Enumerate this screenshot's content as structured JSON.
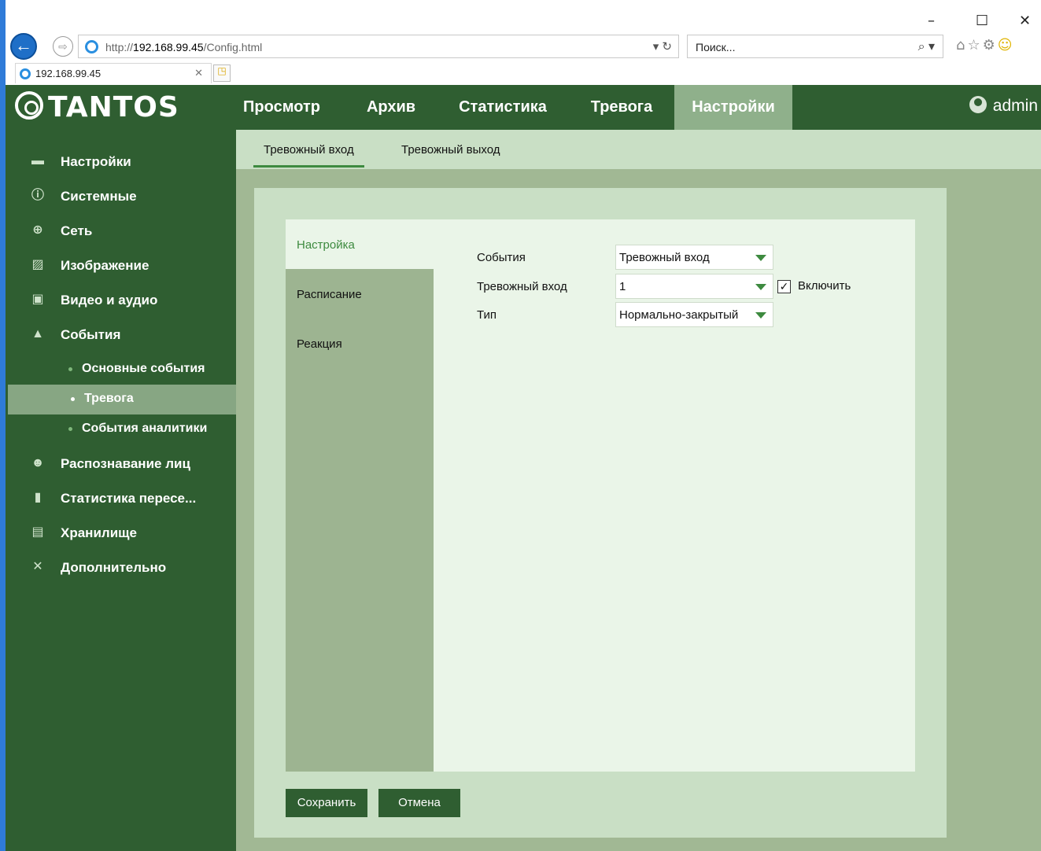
{
  "browser": {
    "url_prefix": "http://",
    "url_host": "192.168.99.45",
    "url_path": "/Config.html",
    "search_placeholder": "Поиск...",
    "tab_title": "192.168.99.45",
    "minimize": "–",
    "maximize": "☐",
    "close": "✕"
  },
  "app": {
    "logo": "TANTOS",
    "user": "admin"
  },
  "nav": [
    {
      "label": "Просмотр"
    },
    {
      "label": "Архив"
    },
    {
      "label": "Статистика"
    },
    {
      "label": "Тревога"
    },
    {
      "label": "Настройки"
    }
  ],
  "sidebar": {
    "items": [
      {
        "label": "Настройки"
      },
      {
        "label": "Системные"
      },
      {
        "label": "Сеть"
      },
      {
        "label": "Изображение"
      },
      {
        "label": "Видео и аудио"
      },
      {
        "label": "События"
      }
    ],
    "sub": [
      {
        "label": "Основные события"
      },
      {
        "label": "Тревога"
      },
      {
        "label": "События аналитики"
      }
    ],
    "items2": [
      {
        "label": "Распознавание лиц"
      },
      {
        "label": "Статистика пересе..."
      },
      {
        "label": "Хранилище"
      },
      {
        "label": "Дополнительно"
      }
    ]
  },
  "subtabs": [
    {
      "label": "Тревожный вход"
    },
    {
      "label": "Тревожный выход"
    }
  ],
  "left_menu": [
    {
      "label": "Настройка"
    },
    {
      "label": "Расписание"
    },
    {
      "label": "Реакция"
    }
  ],
  "form": {
    "events_label": "События",
    "events_value": "Тревожный вход",
    "alarm_in_label": "Тревожный вход",
    "alarm_in_value": "1",
    "enable_label": "Включить",
    "enable_checked": true,
    "type_label": "Тип",
    "type_value": "Нормально-закрытый"
  },
  "buttons": {
    "save": "Сохранить",
    "cancel": "Отмена"
  },
  "colors": {
    "header_bg": "#2f5e31",
    "active_nav": "#8fb08b",
    "accent": "#3d8a3f",
    "panel_bg": "#c9dfc5"
  }
}
